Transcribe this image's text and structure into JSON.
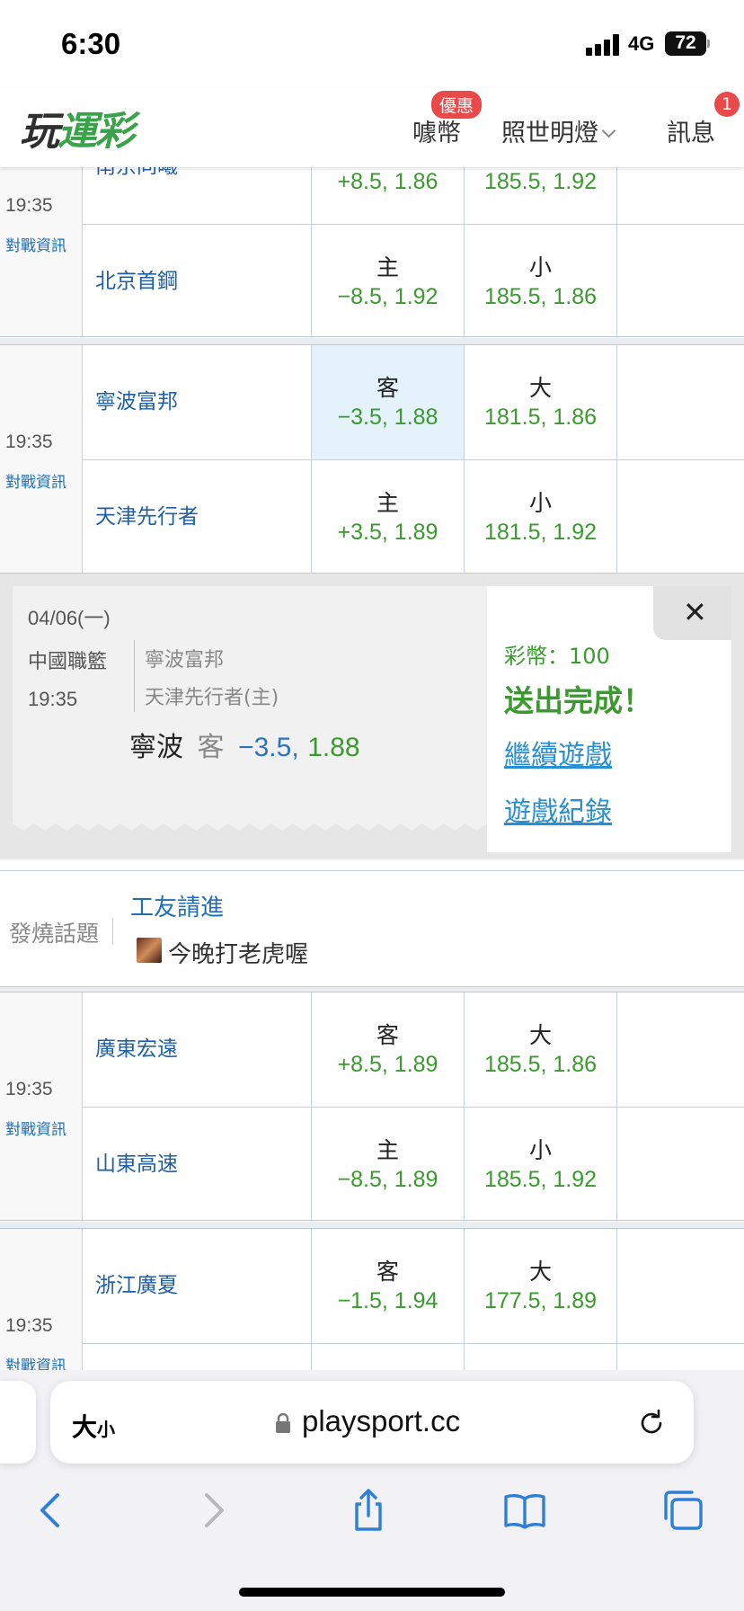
{
  "status_bar": {
    "time": "6:30",
    "network": "4G",
    "battery": "72"
  },
  "header": {
    "logo": {
      "part1": "玩",
      "part2": "運彩"
    },
    "nav": [
      {
        "label": "噱幣",
        "badge": "優惠"
      },
      {
        "label": "照世明燈"
      },
      {
        "label": "訊息",
        "badge": "1"
      }
    ]
  },
  "games": [
    {
      "time": "19:35",
      "info": "對戰資訊",
      "rows": [
        {
          "team": "南京同曦",
          "spread": {
            "label": "",
            "value": "+8.5, 1.86"
          },
          "total": {
            "label": "",
            "value": "185.5, 1.92"
          }
        },
        {
          "team": "北京首鋼",
          "spread": {
            "label": "主",
            "value": "−8.5, 1.92"
          },
          "total": {
            "label": "小",
            "value": "185.5, 1.86"
          }
        }
      ]
    },
    {
      "time": "19:35",
      "info": "對戰資訊",
      "rows": [
        {
          "team": "寧波富邦",
          "spread": {
            "label": "客",
            "value": "−3.5, 1.88"
          },
          "total": {
            "label": "大",
            "value": "181.5, 1.86"
          }
        },
        {
          "team": "天津先行者",
          "spread": {
            "label": "主",
            "value": "+3.5, 1.89"
          },
          "total": {
            "label": "小",
            "value": "181.5, 1.92"
          }
        }
      ]
    },
    {
      "time": "19:35",
      "info": "對戰資訊",
      "rows": [
        {
          "team": "廣東宏遠",
          "spread": {
            "label": "客",
            "value": "+8.5, 1.89"
          },
          "total": {
            "label": "大",
            "value": "185.5, 1.86"
          }
        },
        {
          "team": "山東高速",
          "spread": {
            "label": "主",
            "value": "−8.5, 1.89"
          },
          "total": {
            "label": "小",
            "value": "185.5, 1.92"
          }
        }
      ]
    },
    {
      "time": "19:35",
      "info": "對戰資訊",
      "rows": [
        {
          "team": "浙江廣夏",
          "spread": {
            "label": "客",
            "value": "−1.5, 1.94"
          },
          "total": {
            "label": "大",
            "value": "177.5, 1.89"
          }
        }
      ]
    }
  ],
  "ticket": {
    "date": "04/06(一)",
    "league": "中國職籃",
    "time": "19:35",
    "away_team": "寧波富邦",
    "home_team": "天津先行者(主)",
    "pick_team": "寧波",
    "pick_side": "客",
    "pick_line": "−3.5,",
    "pick_price": "1.88",
    "coins": "彩幣：100",
    "status": "送出完成！",
    "continue_link": "繼續遊戲",
    "history_link": "遊戲紀錄",
    "close": "✕"
  },
  "topics": {
    "label": "發燒話題",
    "items": [
      "工友請進",
      "今晚打老虎喔"
    ]
  },
  "browser": {
    "text_size_big": "大",
    "text_size_small": "小",
    "url": "playsport.cc"
  }
}
